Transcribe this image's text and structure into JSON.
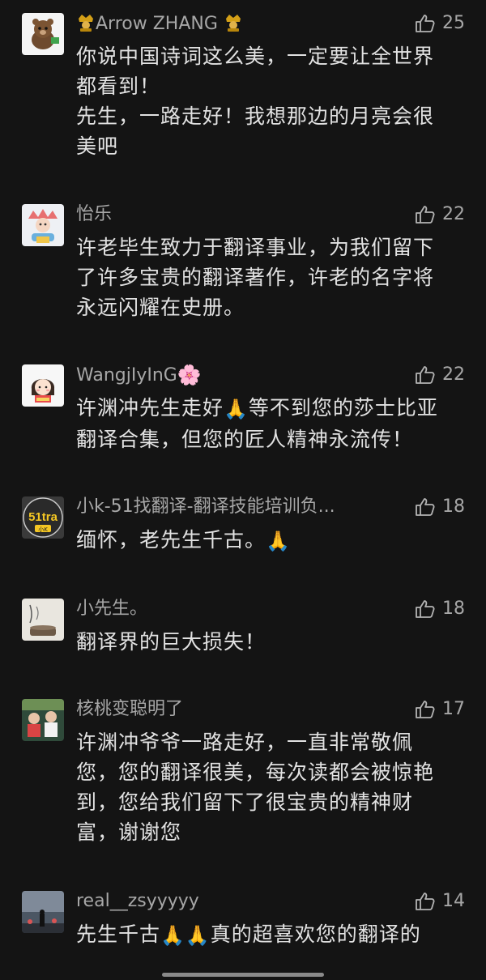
{
  "comments": [
    {
      "username": "Arrow ZHANG",
      "likes": "25",
      "badge_icon": "crown-badge-icon",
      "lines": [
        "你说中国诗词这么美，一定要让全世界",
        "都看到！",
        "先生，一路走好！我想那边的月亮会很",
        "美吧"
      ]
    },
    {
      "username": "怡乐",
      "likes": "22",
      "lines": [
        "许老毕生致力于翻译事业，为我们留下",
        "了许多宝贵的翻译著作，许老的名字将",
        "永远闪耀在史册。"
      ]
    },
    {
      "username": "WangjIyInG",
      "username_emoji": "🌸",
      "likes": "22",
      "line1_a": "许渊冲先生走好",
      "line1_emoji": "🙏",
      "line1_b": "等不到您的莎士比亚",
      "line2": "翻译合集，但您的匠人精神永流传！"
    },
    {
      "username": "小k-51找翻译-翻译技能培训负...",
      "likes": "18",
      "avatar_logo_text": "51tra",
      "avatar_logo_sub": "小K",
      "text": "缅怀，老先生千古。",
      "emoji": "🙏"
    },
    {
      "username": "小先生。",
      "likes": "18",
      "text": "翻译界的巨大损失！"
    },
    {
      "username": "核桃变聪明了",
      "likes": "17",
      "lines": [
        "许渊冲爷爷一路走好，一直非常敬佩",
        "您，您的翻译很美，每次读都会被惊艳",
        "到，您给我们留下了很宝贵的精神财",
        "富，谢谢您"
      ]
    },
    {
      "username": "real__zsyyyyy",
      "likes": "14",
      "text_a": "先生千古",
      "emoji": "🙏🙏",
      "text_b": "真的超喜欢您的翻译的"
    }
  ]
}
